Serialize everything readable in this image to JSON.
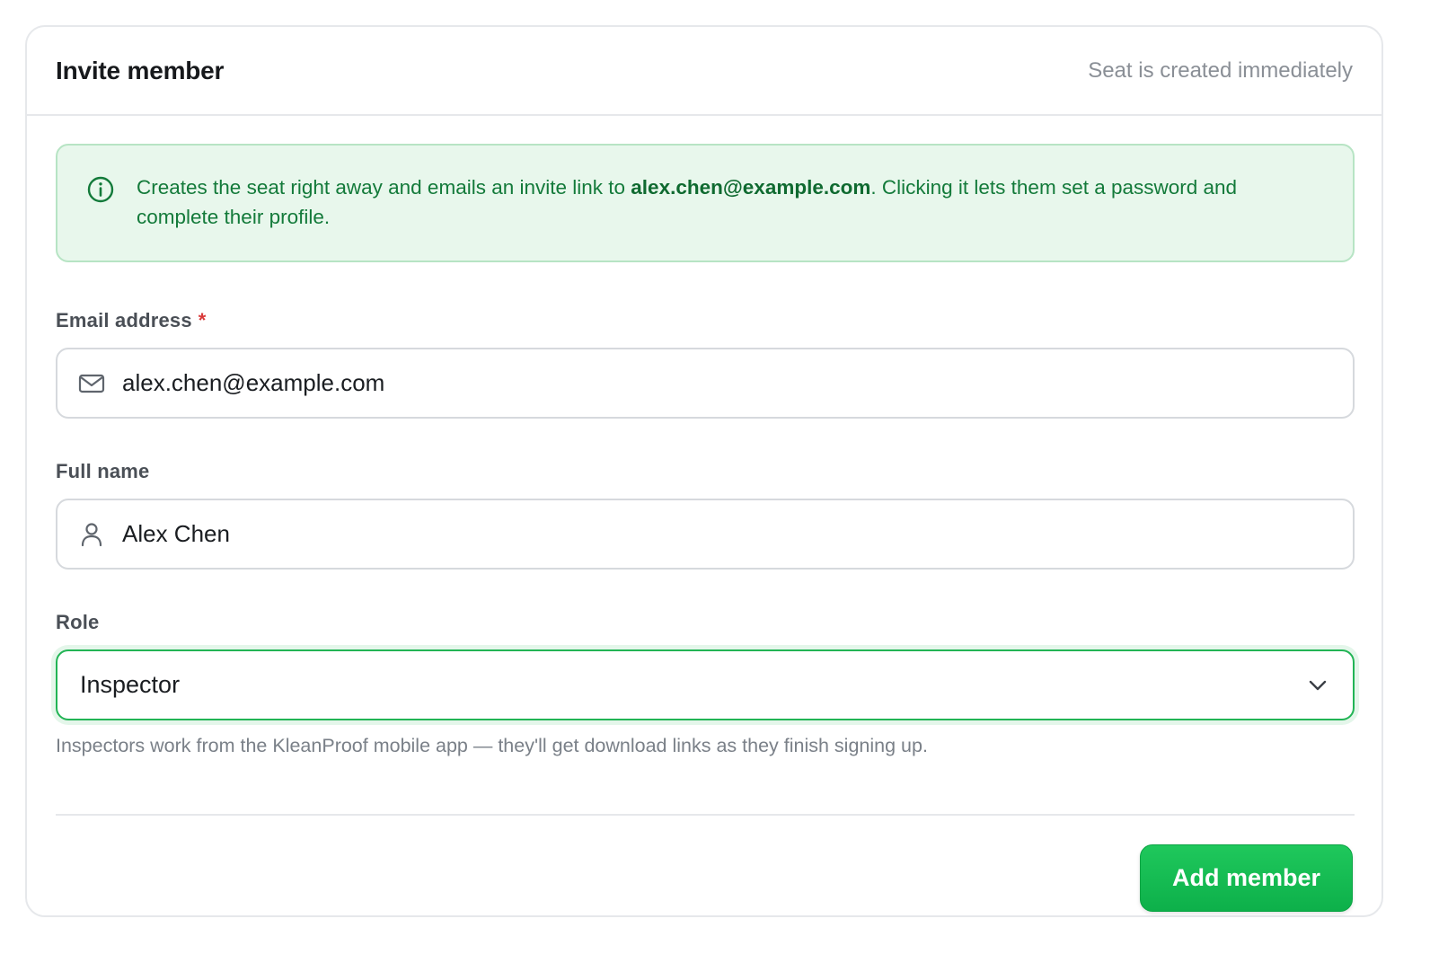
{
  "header": {
    "title": "Invite member",
    "meta": "Seat is created immediately"
  },
  "notice": {
    "icon": "info-icon",
    "text_before": "Creates the seat right away and emails an invite link to ",
    "email": "alex.chen@example.com",
    "text_after": ". Clicking it lets them set a password and complete their profile.",
    "colors": {
      "background": "#e8f7ec",
      "border": "#b7e4c4",
      "text": "#137a3a"
    }
  },
  "form": {
    "email": {
      "label": "Email address",
      "required_marker": "*",
      "icon": "mail-icon",
      "value": "alex.chen@example.com"
    },
    "full_name": {
      "label": "Full name",
      "icon": "user-icon",
      "value": "Alex Chen"
    },
    "role": {
      "label": "Role",
      "selected": "Inspector",
      "icon": "chevron-down-icon",
      "hint": "Inspectors work from the KleanProof mobile app — they'll get download links as they finish signing up."
    }
  },
  "actions": {
    "submit_label": "Add member"
  },
  "colors": {
    "accent": "#1fc85c",
    "required": "#d93a3a"
  }
}
